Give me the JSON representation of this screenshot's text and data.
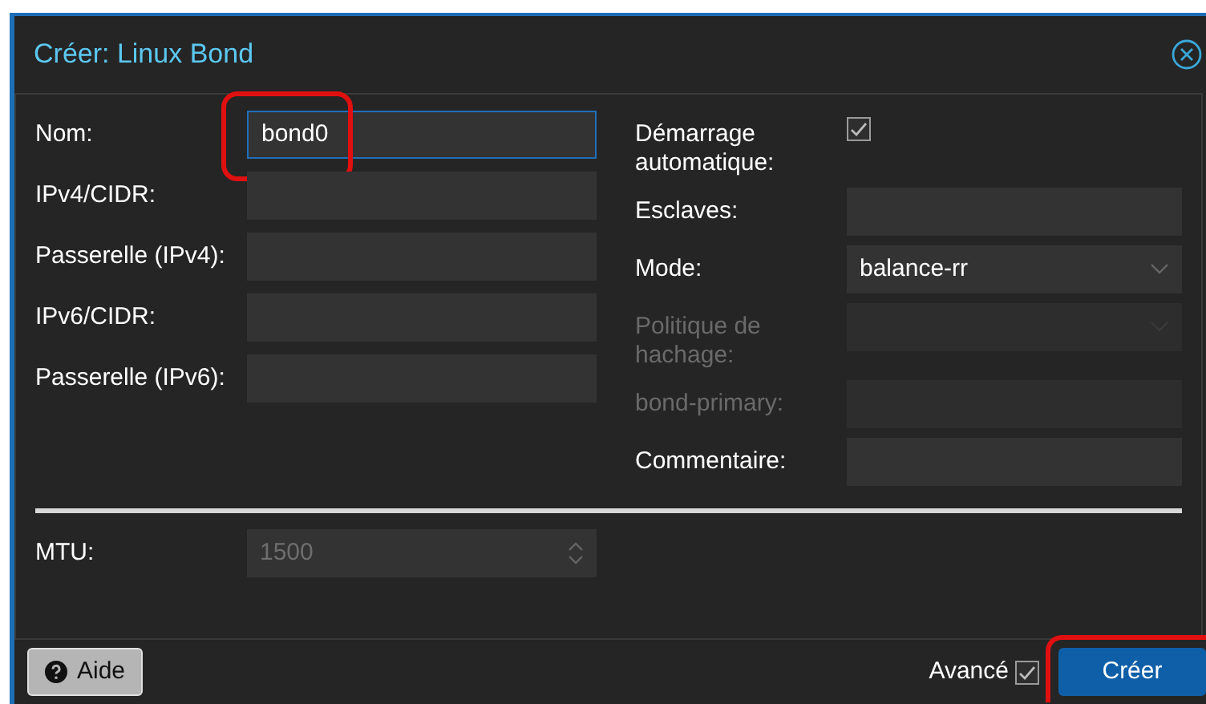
{
  "window": {
    "title": "Créer: Linux Bond"
  },
  "left_fields": [
    {
      "label": "Nom:",
      "kind": "text",
      "value": "bond0",
      "focused": true,
      "disabled": false,
      "highlighted": true
    },
    {
      "label": "IPv4/CIDR:",
      "kind": "text",
      "focused": false,
      "disabled": false,
      "highlighted": false
    },
    {
      "label": "Passerelle (IPv4):",
      "kind": "text",
      "focused": false,
      "disabled": false,
      "highlighted": false
    },
    {
      "label": "IPv6/CIDR:",
      "kind": "text",
      "focused": false,
      "disabled": false,
      "highlighted": false
    },
    {
      "label": "Passerelle (IPv6):",
      "kind": "text",
      "focused": false,
      "disabled": false,
      "highlighted": false
    }
  ],
  "right_fields": [
    {
      "label": "Démarrage automatique:",
      "kind": "checkbox",
      "checked": true,
      "disabled": false
    },
    {
      "label": "Esclaves:",
      "kind": "text",
      "disabled": false
    },
    {
      "label": "Mode:",
      "kind": "select",
      "value": "balance-rr",
      "disabled": false
    },
    {
      "label": "Politique de hachage:",
      "kind": "select",
      "disabled": true
    },
    {
      "label": "bond-primary:",
      "kind": "text",
      "disabled": true
    },
    {
      "label": "Commentaire:",
      "kind": "text",
      "disabled": false
    }
  ],
  "advanced_fields": [
    {
      "label": "MTU:",
      "kind": "spinner",
      "placeholder": "1500",
      "disabled": false
    }
  ],
  "footer": {
    "help_button": "Aide",
    "advanced": {
      "label": "Avancé",
      "checked": true
    },
    "submit_button": {
      "label": "Créer",
      "highlighted": true
    }
  }
}
